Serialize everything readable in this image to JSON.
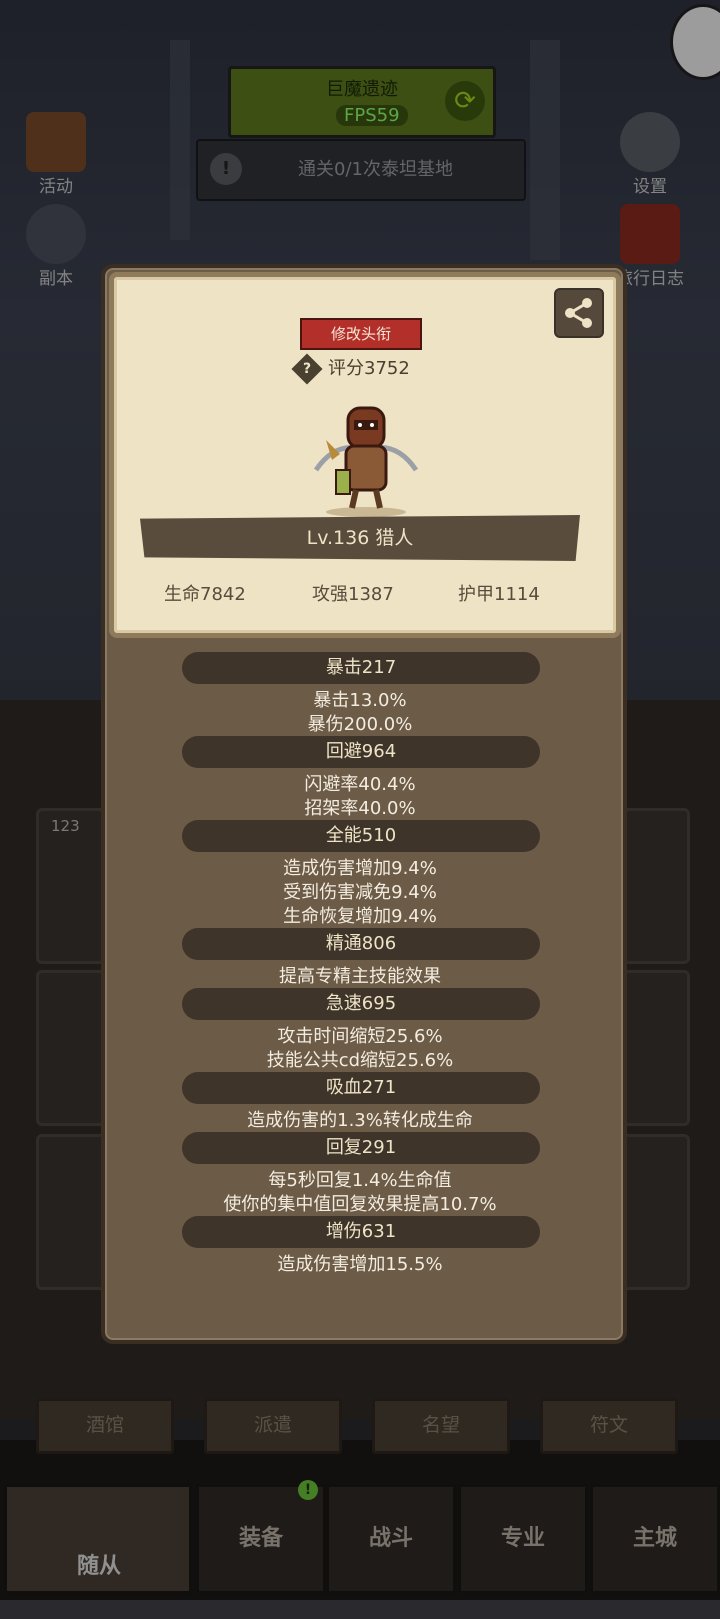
{
  "hud": {
    "zone_name": "巨魔遗迹",
    "fps": "FPS59",
    "quest": "通关0/1次泰坦基地"
  },
  "side_icons": {
    "left": [
      "活动",
      "副本"
    ],
    "right": [
      "设置",
      "旅行日志"
    ]
  },
  "roster": {
    "first_card_number": "123"
  },
  "tabs": [
    "酒馆",
    "派遣",
    "名望",
    "符文"
  ],
  "nav": [
    "随从",
    "装备",
    "战斗",
    "专业",
    "主城"
  ],
  "modal": {
    "title_button": "修改头衔",
    "rating": "评分3752",
    "level_class": "Lv.136 猎人",
    "base_stats": [
      "生命7842",
      "攻强1387",
      "护甲1114"
    ],
    "sections": [
      {
        "head": "暴击217",
        "lines": [
          "暴击13.0%",
          "暴伤200.0%"
        ]
      },
      {
        "head": "回避964",
        "lines": [
          "闪避率40.4%",
          "招架率40.0%"
        ]
      },
      {
        "head": "全能510",
        "lines": [
          "造成伤害增加9.4%",
          "受到伤害减免9.4%",
          "生命恢复增加9.4%"
        ]
      },
      {
        "head": "精通806",
        "lines": [
          "提高专精主技能效果"
        ]
      },
      {
        "head": "急速695",
        "lines": [
          "攻击时间缩短25.6%",
          "技能公共cd缩短25.6%"
        ]
      },
      {
        "head": "吸血271",
        "lines": [
          "造成伤害的1.3%转化成生命"
        ]
      },
      {
        "head": "回复291",
        "lines": [
          "每5秒回复1.4%生命值",
          "使你的集中值回复效果提高10.7%"
        ]
      },
      {
        "head": "增伤631",
        "lines": [
          "造成伤害增加15.5%"
        ]
      }
    ]
  },
  "colors": {
    "card_bg": "#efe3c6",
    "modal_bg": "#6b5b47",
    "stat_header_bg": "#3e342a",
    "title_button_bg": "#b3302a",
    "fps_green": "#8dff6a"
  }
}
